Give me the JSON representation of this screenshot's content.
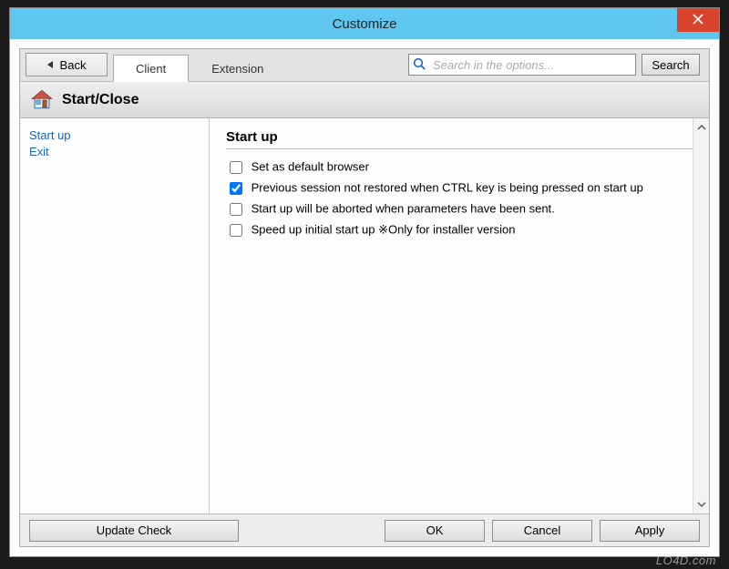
{
  "window": {
    "title": "Customize"
  },
  "toolbar": {
    "back_label": "Back",
    "tabs": [
      {
        "label": "Client",
        "active": true
      },
      {
        "label": "Extension",
        "active": false
      }
    ],
    "search_placeholder": "Search in the options...",
    "search_button": "Search"
  },
  "section": {
    "title": "Start/Close"
  },
  "sidebar": {
    "items": [
      {
        "label": "Start up"
      },
      {
        "label": "Exit"
      }
    ]
  },
  "panel": {
    "heading": "Start up",
    "options": [
      {
        "label": "Set as default browser",
        "checked": false
      },
      {
        "label": "Previous session not restored when CTRL key is being pressed on start up",
        "checked": true
      },
      {
        "label": "Start up will be aborted when parameters have been sent.",
        "checked": false
      },
      {
        "label": "Speed up initial start up ※Only for installer version",
        "checked": false
      }
    ]
  },
  "footer": {
    "update": "Update Check",
    "ok": "OK",
    "cancel": "Cancel",
    "apply": "Apply"
  },
  "watermark": "LO4D.com"
}
